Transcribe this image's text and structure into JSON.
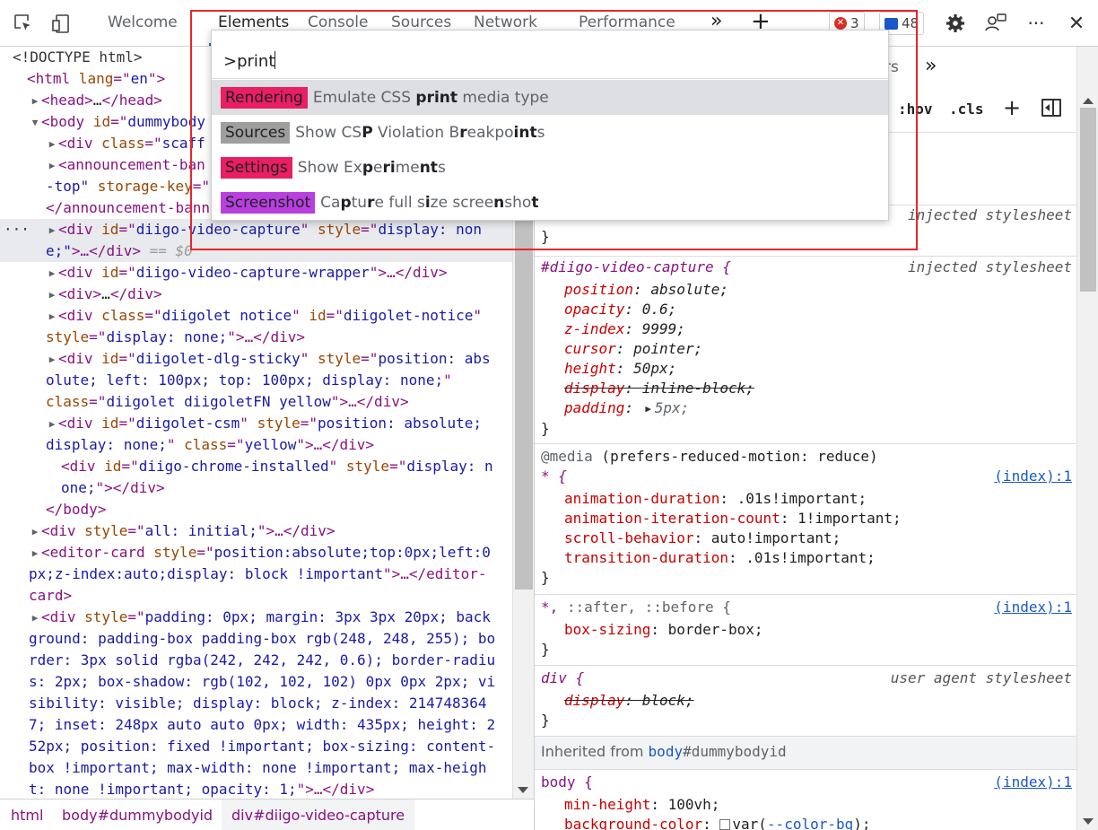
{
  "toolbar": {
    "tabs": [
      "Welcome",
      "Elements",
      "Console",
      "Sources",
      "Network",
      "Performance"
    ],
    "more_tabs": "»",
    "add_tab": "+",
    "errors_count": "3",
    "messages_count": "48",
    "colors": {
      "error": "#d93025",
      "messages": "#1a57c8"
    }
  },
  "command_menu": {
    "query": ">print",
    "items": [
      {
        "badge": "Rendering",
        "badge_color": "#e91e63",
        "text_parts": [
          "Emulate CSS ",
          "print",
          " media type"
        ]
      },
      {
        "badge": "Sources",
        "badge_color": "#9e9e9e",
        "text_parts": [
          "Show CS",
          "P",
          " Violation B",
          "r",
          "eakpo",
          "int",
          "s"
        ]
      },
      {
        "badge": "Settings",
        "badge_color": "#e91e63",
        "text_parts": [
          "Show Ex",
          "p",
          "e",
          "ri",
          "me",
          "nt",
          "s"
        ]
      },
      {
        "badge": "Screenshot",
        "badge_color": "#b93fdf",
        "text_parts": [
          "Ca",
          "p",
          "tu",
          "r",
          "e full s",
          "i",
          "ze scree",
          "n",
          "sho",
          "t"
        ]
      }
    ]
  },
  "styles_header": {
    "partial_tab": "rs",
    "more": "»",
    "hov": ":hov",
    "cls": ".cls"
  },
  "tree": {
    "doctype": "<!DOCTYPE html>",
    "html_open": [
      "<html",
      " lang",
      "=\"",
      "en",
      "\">"
    ],
    "head": [
      "<head>",
      "…",
      "</head>"
    ],
    "body_open": [
      "<body",
      " id",
      "=\"",
      "dummybody"
    ],
    "div_class": [
      "<div",
      " class",
      "=\"",
      "scaff"
    ],
    "announce": [
      "<announcement-ban"
    ],
    "announce_cont": [
      "-top\"",
      " storage-key",
      "=\""
    ],
    "announce_close": [
      "</announcement-bann"
    ],
    "sel_line1": [
      "<div",
      " id",
      "=\"",
      "diigo-video-capture",
      "\"",
      " style",
      "=\"",
      "display: non"
    ],
    "sel_line2": [
      "e;\"",
      ">…</div>",
      " == $0"
    ],
    "wrapper": [
      "<div",
      " id",
      "=\"",
      "diigo-video-capture-wrapper",
      "\">…</div>"
    ],
    "div_empty": [
      "<div>",
      "…",
      "</div>"
    ],
    "notice1": [
      "<div",
      " class",
      "=\"",
      "diigolet notice",
      "\"",
      " id",
      "=\"",
      "diigolet-notice",
      "\""
    ],
    "notice2": [
      "style",
      "=\"",
      "display: none;",
      "\">…</div>"
    ],
    "sticky1": [
      "<div",
      " id",
      "=\"",
      "diigolet-dlg-sticky",
      "\"",
      " style",
      "=\"",
      "position: abs"
    ],
    "sticky2": [
      "olute; left: 100px; top: 100px; display: none;",
      "\""
    ],
    "sticky3": [
      "class",
      "=\"",
      "diigolet diigoletFN yellow",
      "\">…</div>"
    ],
    "csm1": [
      "<div",
      " id",
      "=\"",
      "diigolet-csm",
      "\"",
      " style",
      "=\"",
      "position: absolute;"
    ],
    "csm2": [
      "display: none;",
      "\"",
      " class",
      "=\"",
      "yellow",
      "\">…</div>"
    ],
    "chrome1": [
      "<div",
      " id",
      "=\"",
      "diigo-chrome-installed",
      "\"",
      " style",
      "=\"",
      "display: n"
    ],
    "chrome2": [
      "one;",
      "\"></div>"
    ],
    "body_close": "</body>",
    "div_all": [
      "<div",
      " style",
      "=\"",
      "all: initial;",
      "\">…</div>"
    ],
    "editor1": [
      "<editor-card",
      " style",
      "=\"",
      "position:absolute;top:0px;left:0"
    ],
    "editor2": [
      "px;z-index:auto;display: block !important",
      "\">…</editor-"
    ],
    "editor3": "card>",
    "pad_lines": [
      [
        "<div",
        " style",
        "=\"",
        "padding: 0px; margin: 3px 3px 20px; back"
      ],
      "ground: padding-box padding-box rgb(248, 248, 255); bo",
      "rder: 3px solid rgba(242, 242, 242, 0.6); border-radiu",
      "s: 2px; box-shadow: rgb(102, 102, 102) 0px 0px 2px; vi",
      "sibility: visible; display: block; z-index: 214748364",
      "7; inset: 248px auto auto 0px; width: 435px; height: 2",
      "52px; position: fixed !important; box-sizing: content-",
      "box !important; max-width: none !important; max-heigh",
      [
        "t: none !important; opacity: 1;",
        "\">…</div>"
      ]
    ]
  },
  "breadcrumbs": [
    "html",
    "body#dummybodyid",
    "div#diigo-video-capture"
  ],
  "styles": {
    "partial_rule_close": "}",
    "partial_src": "injected stylesheet",
    "rule1": {
      "selector": "#diigo-video-capture {",
      "source": "injected stylesheet",
      "props": [
        {
          "name": "position",
          "value": "absolute;"
        },
        {
          "name": "opacity",
          "value": "0.6;"
        },
        {
          "name": "z-index",
          "value": "9999;"
        },
        {
          "name": "cursor",
          "value": "pointer;"
        },
        {
          "name": "height",
          "value": "50px;"
        },
        {
          "name": "display",
          "value": "inline-block;"
        },
        {
          "name": "padding",
          "value": "5px;"
        }
      ]
    },
    "media": {
      "at": "@media",
      "query": " (prefers-reduced-motion: reduce)"
    },
    "rule2": {
      "selector": "* {",
      "source": "(index):1",
      "props": [
        {
          "name": "animation-duration",
          "value": ".01s!important;"
        },
        {
          "name": "animation-iteration-count",
          "value": "1!important;"
        },
        {
          "name": "scroll-behavior",
          "value": "auto!important;"
        },
        {
          "name": "transition-duration",
          "value": ".01s!important;"
        }
      ]
    },
    "rule3": {
      "selector_star": "*, ",
      "selector_rest": "::after, ::before {",
      "source": "(index):1",
      "prop": "box-sizing",
      "value": "border-box;"
    },
    "rule4": {
      "selector": "div {",
      "source": "user agent stylesheet",
      "prop": "display",
      "value": "block;"
    },
    "inherited_label": "Inherited from ",
    "inherited_node_tag": "body",
    "inherited_node_id": "#dummybodyid",
    "rule5": {
      "selector": "body {",
      "source": "(index):1",
      "prop1": "min-height",
      "val1": "100vh;",
      "prop2": "background-color",
      "val2": "var(",
      "val2_var": "--color-bg",
      "val2_end": ");"
    },
    "close": "}"
  }
}
